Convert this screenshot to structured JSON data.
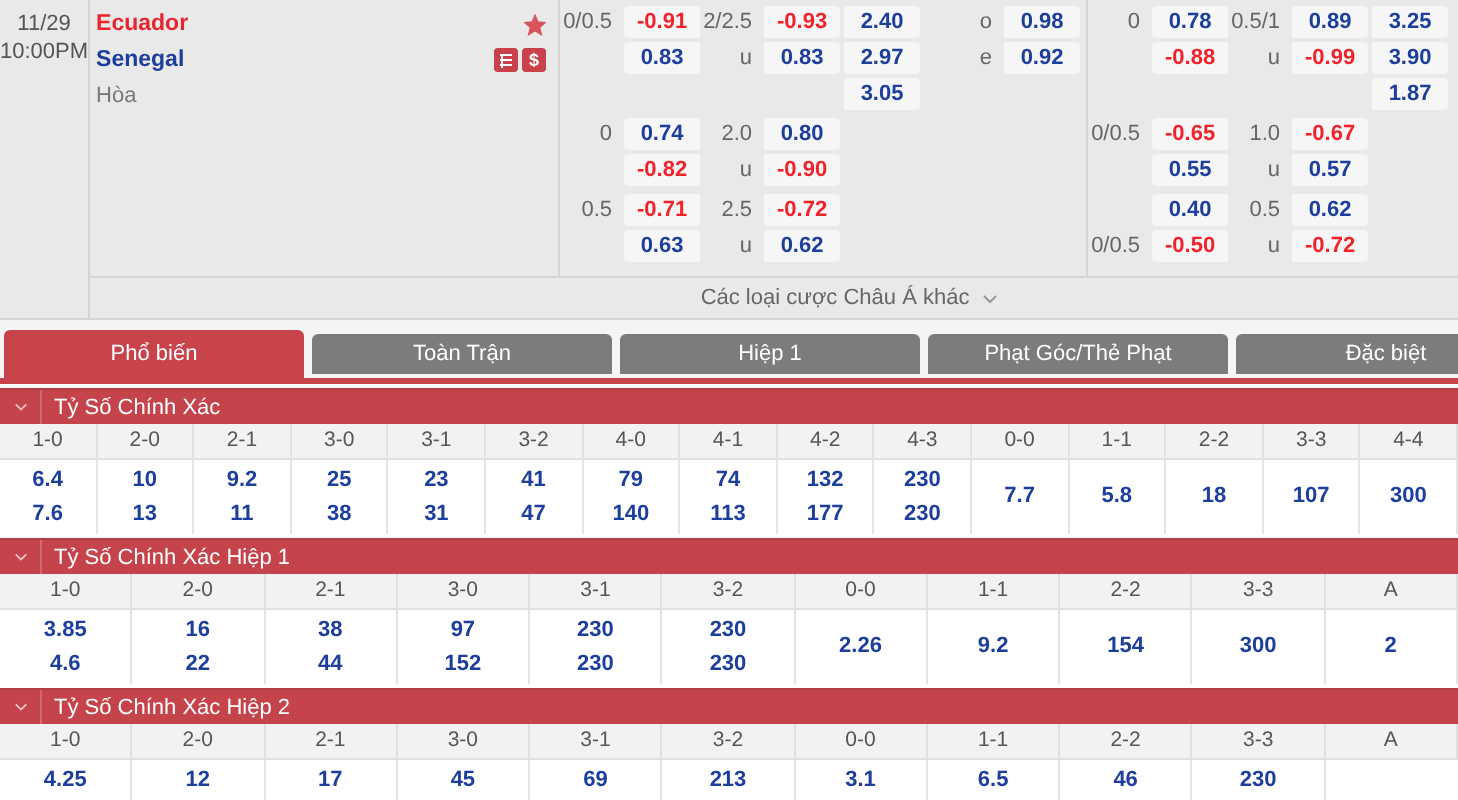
{
  "match": {
    "date": "11/29",
    "time": "10:00PM",
    "home": "Ecuador",
    "away": "Senegal",
    "draw_label": "Hòa",
    "favorite": true,
    "badges": [
      {
        "kind": "list"
      },
      {
        "kind": "text",
        "text": "$"
      }
    ]
  },
  "odds_halves": [
    {
      "lines": [
        {
          "rows": [
            {
              "hdp_label": "0/0.5",
              "hdp": "-0.91",
              "ou_label": "2/2.5",
              "ou": "-0.93",
              "x12": "2.40",
              "oe_label": "o",
              "oe": "0.98"
            },
            {
              "hdp": "0.83",
              "ou_label": "u",
              "ou": "0.83",
              "x12": "2.97",
              "oe_label": "e",
              "oe": "0.92"
            },
            {
              "x12": "3.05"
            }
          ]
        },
        {
          "rows": [
            {
              "hdp_label": "0",
              "hdp": "0.74",
              "ou_label": "2.0",
              "ou": "0.80"
            },
            {
              "hdp": "-0.82",
              "ou_label": "u",
              "ou": "-0.90"
            }
          ]
        },
        {
          "rows": [
            {
              "hdp_label": "0.5",
              "hdp": "-0.71",
              "ou_label": "2.5",
              "ou": "-0.72"
            },
            {
              "hdp": "0.63",
              "ou_label": "u",
              "ou": "0.62"
            }
          ]
        }
      ]
    },
    {
      "lines": [
        {
          "rows": [
            {
              "hdp_label": "0",
              "hdp": "0.78",
              "ou_label": "0.5/1",
              "ou": "0.89",
              "x12": "3.25"
            },
            {
              "hdp": "-0.88",
              "ou_label": "u",
              "ou": "-0.99",
              "x12": "3.90"
            },
            {
              "x12": "1.87"
            }
          ]
        },
        {
          "rows": [
            {
              "hdp_label": "0/0.5",
              "hdp": "-0.65",
              "ou_label": "1.0",
              "ou": "-0.67"
            },
            {
              "hdp": "0.55",
              "ou_label": "u",
              "ou": "0.57"
            }
          ]
        },
        {
          "rows": [
            {
              "hdp": "0.40",
              "ou_label": "0.5",
              "ou": "0.62"
            },
            {
              "hdp_label": "0/0.5",
              "hdp": "-0.50",
              "ou_label": "u",
              "ou": "-0.72"
            }
          ]
        }
      ]
    }
  ],
  "more_markets": "Các loại cược Châu Á khác",
  "tabs": [
    {
      "label": "Phổ biến",
      "selected": true
    },
    {
      "label": "Toàn Trận",
      "selected": false
    },
    {
      "label": "Hiệp 1",
      "selected": false
    },
    {
      "label": "Phạt Góc/Thẻ Phạt",
      "selected": false
    },
    {
      "label": "Đặc biệt",
      "selected": false
    }
  ],
  "sections": [
    {
      "title": "Tỷ Số Chính Xác",
      "columns": [
        {
          "label": "1-0",
          "values": [
            "6.4",
            "7.6"
          ]
        },
        {
          "label": "2-0",
          "values": [
            "10",
            "13"
          ]
        },
        {
          "label": "2-1",
          "values": [
            "9.2",
            "11"
          ]
        },
        {
          "label": "3-0",
          "values": [
            "25",
            "38"
          ]
        },
        {
          "label": "3-1",
          "values": [
            "23",
            "31"
          ]
        },
        {
          "label": "3-2",
          "values": [
            "41",
            "47"
          ]
        },
        {
          "label": "4-0",
          "values": [
            "79",
            "140"
          ]
        },
        {
          "label": "4-1",
          "values": [
            "74",
            "113"
          ]
        },
        {
          "label": "4-2",
          "values": [
            "132",
            "177"
          ]
        },
        {
          "label": "4-3",
          "values": [
            "230",
            "230"
          ]
        },
        {
          "label": "0-0",
          "values": [
            "7.7"
          ]
        },
        {
          "label": "1-1",
          "values": [
            "5.8"
          ]
        },
        {
          "label": "2-2",
          "values": [
            "18"
          ]
        },
        {
          "label": "3-3",
          "values": [
            "107"
          ]
        },
        {
          "label": "4-4",
          "values": [
            "300"
          ]
        }
      ]
    },
    {
      "title": "Tỷ Số Chính Xác Hiệp 1",
      "columns": [
        {
          "label": "1-0",
          "values": [
            "3.85",
            "4.6"
          ]
        },
        {
          "label": "2-0",
          "values": [
            "16",
            "22"
          ]
        },
        {
          "label": "2-1",
          "values": [
            "38",
            "44"
          ]
        },
        {
          "label": "3-0",
          "values": [
            "97",
            "152"
          ]
        },
        {
          "label": "3-1",
          "values": [
            "230",
            "230"
          ]
        },
        {
          "label": "3-2",
          "values": [
            "230",
            "230"
          ]
        },
        {
          "label": "0-0",
          "values": [
            "2.26"
          ]
        },
        {
          "label": "1-1",
          "values": [
            "9.2"
          ]
        },
        {
          "label": "2-2",
          "values": [
            "154"
          ]
        },
        {
          "label": "3-3",
          "values": [
            "300"
          ]
        },
        {
          "label": "A",
          "values": [
            "2"
          ]
        }
      ]
    },
    {
      "title": "Tỷ Số Chính Xác Hiệp 2",
      "columns": [
        {
          "label": "1-0",
          "values": [
            "4.25"
          ]
        },
        {
          "label": "2-0",
          "values": [
            "12"
          ]
        },
        {
          "label": "2-1",
          "values": [
            "17"
          ]
        },
        {
          "label": "3-0",
          "values": [
            "45"
          ]
        },
        {
          "label": "3-1",
          "values": [
            "69"
          ]
        },
        {
          "label": "3-2",
          "values": [
            "213"
          ]
        },
        {
          "label": "0-0",
          "values": [
            "3.1"
          ]
        },
        {
          "label": "1-1",
          "values": [
            "6.5"
          ]
        },
        {
          "label": "2-2",
          "values": [
            "46"
          ]
        },
        {
          "label": "3-3",
          "values": [
            "230"
          ]
        },
        {
          "label": "A"
        }
      ]
    }
  ]
}
